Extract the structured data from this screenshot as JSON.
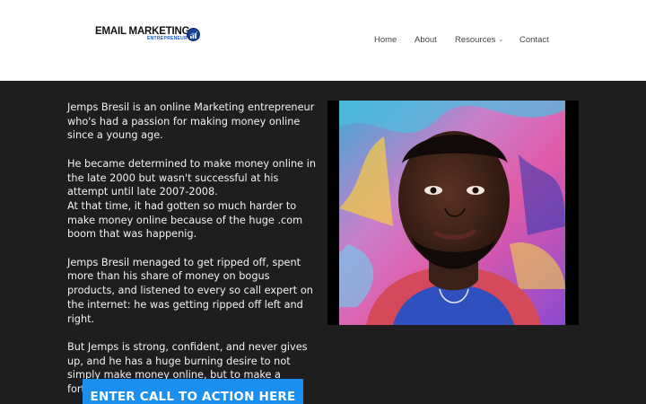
{
  "brand": {
    "title": "EMAIL MARKETING",
    "subtitle": "ENTREPRENEUR"
  },
  "nav": {
    "home": "Home",
    "about": "About",
    "resources": "Resources",
    "contact": "Contact"
  },
  "content": {
    "paragraphs": [
      "Jemps Bresil is an online Marketing entrepreneur who's had a passion for making money online since a young age.",
      "He became determined to make money online in the late 2000 but wasn't successful at his attempt until late 2007-2008.",
      "At that time, it had gotten so much harder to make money online because of the huge .com boom that was happenig.",
      "Jemps Bresil menaged to get ripped off, spent more than his share of money on bogus products, and listened to every so call expert on the internet: he was getting ripped off left and right.",
      "But Jemps is strong, confident, and never gives up, and he has a huge burning desire to not simply make money online, but to make a fortune!!"
    ]
  },
  "cta": {
    "label": "ENTER CALL TO ACTION HERE"
  },
  "colors": {
    "background": "#1e1e1e",
    "header": "#ffffff",
    "cta": "#1a8ff0"
  }
}
